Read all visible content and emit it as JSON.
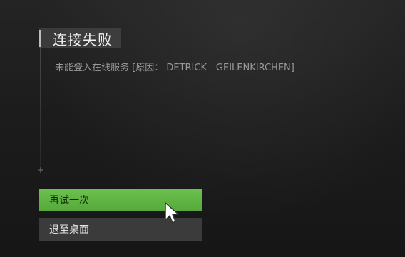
{
  "dialog": {
    "title": "连接失败",
    "message": "未能登入在线服务 [原因： DETRICK - GEILENKIRCHEN]"
  },
  "buttons": {
    "retry_label": "再试一次",
    "exit_label": "退至桌面"
  },
  "decorations": {
    "plus_glyph": "+"
  },
  "colors": {
    "retry_bg": "#62b646",
    "exit_bg": "#4a4a4a",
    "background": "#1c1c1c"
  },
  "icons": {
    "cursor": "mouse-pointer-icon"
  }
}
